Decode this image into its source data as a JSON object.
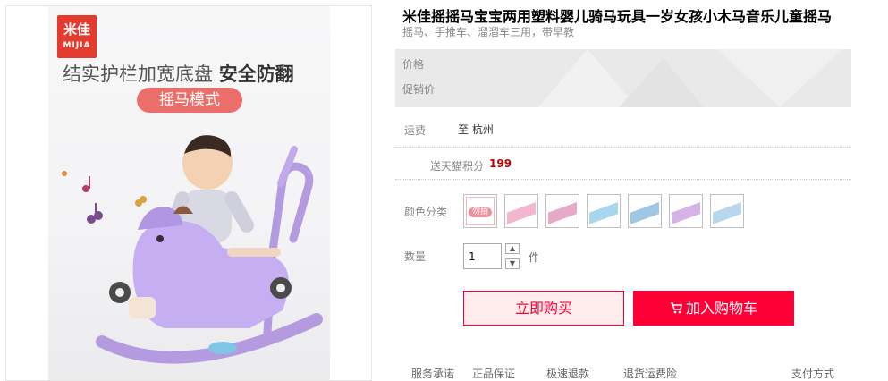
{
  "image": {
    "brand_logo": {
      "cn": "米佳",
      "en": "MIJIA"
    },
    "headline_plain": "结实护栏加宽底盘",
    "headline_bold": "安全防翻",
    "mode_pill": "摇马模式"
  },
  "product": {
    "title": "米佳摇摇马宝宝两用塑料婴儿骑马玩具一岁女孩小木马音乐儿童摇马",
    "subtitle": "摇马、手推车、溜溜车三用，带早教"
  },
  "price": {
    "price_label": "价格",
    "promo_label": "促销价"
  },
  "shipping": {
    "label": "运费",
    "value": "至 杭州"
  },
  "points": {
    "label": "送天猫积分",
    "value": "199"
  },
  "color": {
    "label": "颜色分类",
    "options": [
      {
        "icon": "promo-badge-thumb",
        "text": "勿拍",
        "color": "#f08fa0"
      },
      {
        "icon": "pink-rocking-horse-thumb",
        "color": "#f2b7cf"
      },
      {
        "icon": "pink-rocking-horse-thumb",
        "color": "#e8a8c8"
      },
      {
        "icon": "blue-rocking-horse-thumb",
        "color": "#a9d6ef"
      },
      {
        "icon": "blue-rocking-horse-thumb",
        "color": "#9ec7e6"
      },
      {
        "icon": "purple-rocking-horse-thumb",
        "color": "#d6b3e7"
      },
      {
        "icon": "blue-rocking-horse-thumb",
        "color": "#b7d7ee"
      }
    ]
  },
  "quantity": {
    "label": "数量",
    "value": "1",
    "unit": "件"
  },
  "buttons": {
    "buy": "立即购买",
    "cart": "加入购物车"
  },
  "services": [
    "服务承诺",
    "正品保证",
    "极速退款",
    "退货运费险",
    "支付方式"
  ],
  "colors": {
    "accent": "#ff0036",
    "points": "#c40000"
  }
}
